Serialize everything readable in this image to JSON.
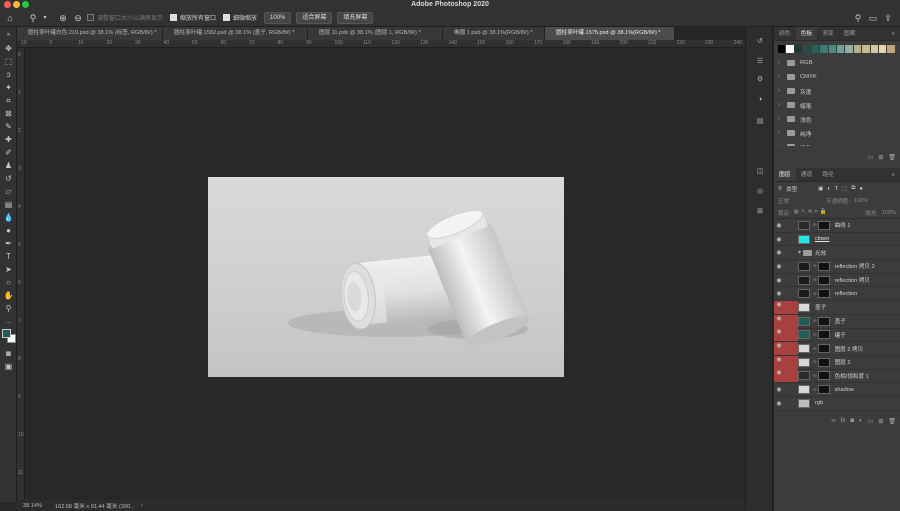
{
  "app": {
    "title": "Adobe Photoshop 2020"
  },
  "options_bar": {
    "zoom_icon": "zoom-icon",
    "resize_windows": "调整窗口大小以满屏显示",
    "zoom_all_windows": "缩放所有窗口",
    "scrubby_zoom": "细微缩放",
    "zoom_percent": "100%",
    "fit_screen": "适合屏幕",
    "fill_screen": "填充屏幕"
  },
  "doc_tabs": [
    {
      "label": "圆柱茶叶罐白色.219.psd @ 38.1% (标签, RGB/8#) *",
      "active": false
    },
    {
      "label": "圆柱茶叶罐.1582.psd @ 38.1% (盖子, RGB/8#) *",
      "active": false
    },
    {
      "label": "图层 11.psb @ 38.1% (图层 1, RGB/8#) *",
      "active": false
    },
    {
      "label": "椭圆 1.psb @ 38.1%(RGB/8#) *",
      "active": false
    },
    {
      "label": "圆柱茶叶罐.1575.psd @ 38.1%(RGB/8#) *",
      "active": true
    }
  ],
  "ruler_top": [
    "10",
    "0",
    "10",
    "20",
    "30",
    "40",
    "50",
    "60",
    "70",
    "80",
    "90",
    "100",
    "110",
    "120",
    "130",
    "140",
    "150",
    "160",
    "170",
    "180",
    "190",
    "200",
    "210",
    "220",
    "230",
    "240"
  ],
  "ruler_left": [
    "0",
    "1",
    "2",
    "3",
    "4",
    "5",
    "6",
    "7",
    "8",
    "9",
    "10",
    "11"
  ],
  "status": {
    "zoom": "38.14%",
    "doc_size": "162.56 毫米 x 91.44 毫米 (300..."
  },
  "swatches_panel": {
    "tabs": [
      "颜色",
      "色板",
      "渐变",
      "图案"
    ],
    "active_tab": "色板",
    "colors": [
      "#000000",
      "#ffffff",
      "#1b3b36",
      "#274b45",
      "#2e5f57",
      "#3d7a70",
      "#4f8a80",
      "#6aa296",
      "#90b0a4",
      "#b5b08a",
      "#c9b98e",
      "#d7c79c",
      "#e5d6ae",
      "#c0a87a"
    ],
    "groups": [
      "RGB",
      "CMYK",
      "灰度",
      "蜡笔",
      "浅色",
      "纯净",
      "暗色"
    ]
  },
  "layers_panel": {
    "tabs": [
      "图层",
      "通道",
      "路径"
    ],
    "active_tab": "图层",
    "kind_filter": "类型",
    "blend_mode": "正常",
    "opacity_label": "不透明度:",
    "opacity_value": "100%",
    "lock_label": "锁定:",
    "fill_label": "填充:",
    "fill_value": "100%",
    "layers": [
      {
        "name": "曲线 1",
        "thumb": "adj",
        "mask": true,
        "red": false,
        "underline": false
      },
      {
        "name": "clown",
        "thumb": "cyan",
        "mask": false,
        "red": false,
        "underline": true
      },
      {
        "name": "光效",
        "thumb": "folder",
        "mask": false,
        "red": false,
        "underline": false
      },
      {
        "name": "reflection 拷贝 2",
        "thumb": "dark",
        "mask": true,
        "red": false,
        "underline": false
      },
      {
        "name": "reflection 拷贝",
        "thumb": "dark",
        "mask": true,
        "red": false,
        "underline": false
      },
      {
        "name": "reflection",
        "thumb": "dark",
        "mask": true,
        "red": false,
        "underline": false
      },
      {
        "name": "盖子",
        "thumb": "light",
        "mask": false,
        "red": true,
        "underline": false
      },
      {
        "name": "盖子",
        "thumb": "teal",
        "mask": true,
        "red": true,
        "underline": false
      },
      {
        "name": "罐子",
        "thumb": "teal",
        "mask": true,
        "red": true,
        "underline": false
      },
      {
        "name": "图层 2 拷贝",
        "thumb": "light",
        "mask": true,
        "red": true,
        "underline": false
      },
      {
        "name": "图层 2",
        "thumb": "light",
        "mask": true,
        "red": true,
        "underline": false
      },
      {
        "name": "色相/饱和度 1",
        "thumb": "adj",
        "mask": true,
        "red": true,
        "underline": false
      },
      {
        "name": "shadow",
        "thumb": "light",
        "mask": true,
        "red": false,
        "underline": false
      },
      {
        "name": "rgb",
        "thumb": "grey",
        "mask": false,
        "red": false,
        "underline": false
      }
    ]
  },
  "colors": {
    "ui_bg": "#323232",
    "canvas_bg": "#282828",
    "panel_bg": "#3c3c3c",
    "highlight_red": "#a84040",
    "foreground_swatch": "#1f5c55",
    "background_swatch": "#ffffff"
  }
}
